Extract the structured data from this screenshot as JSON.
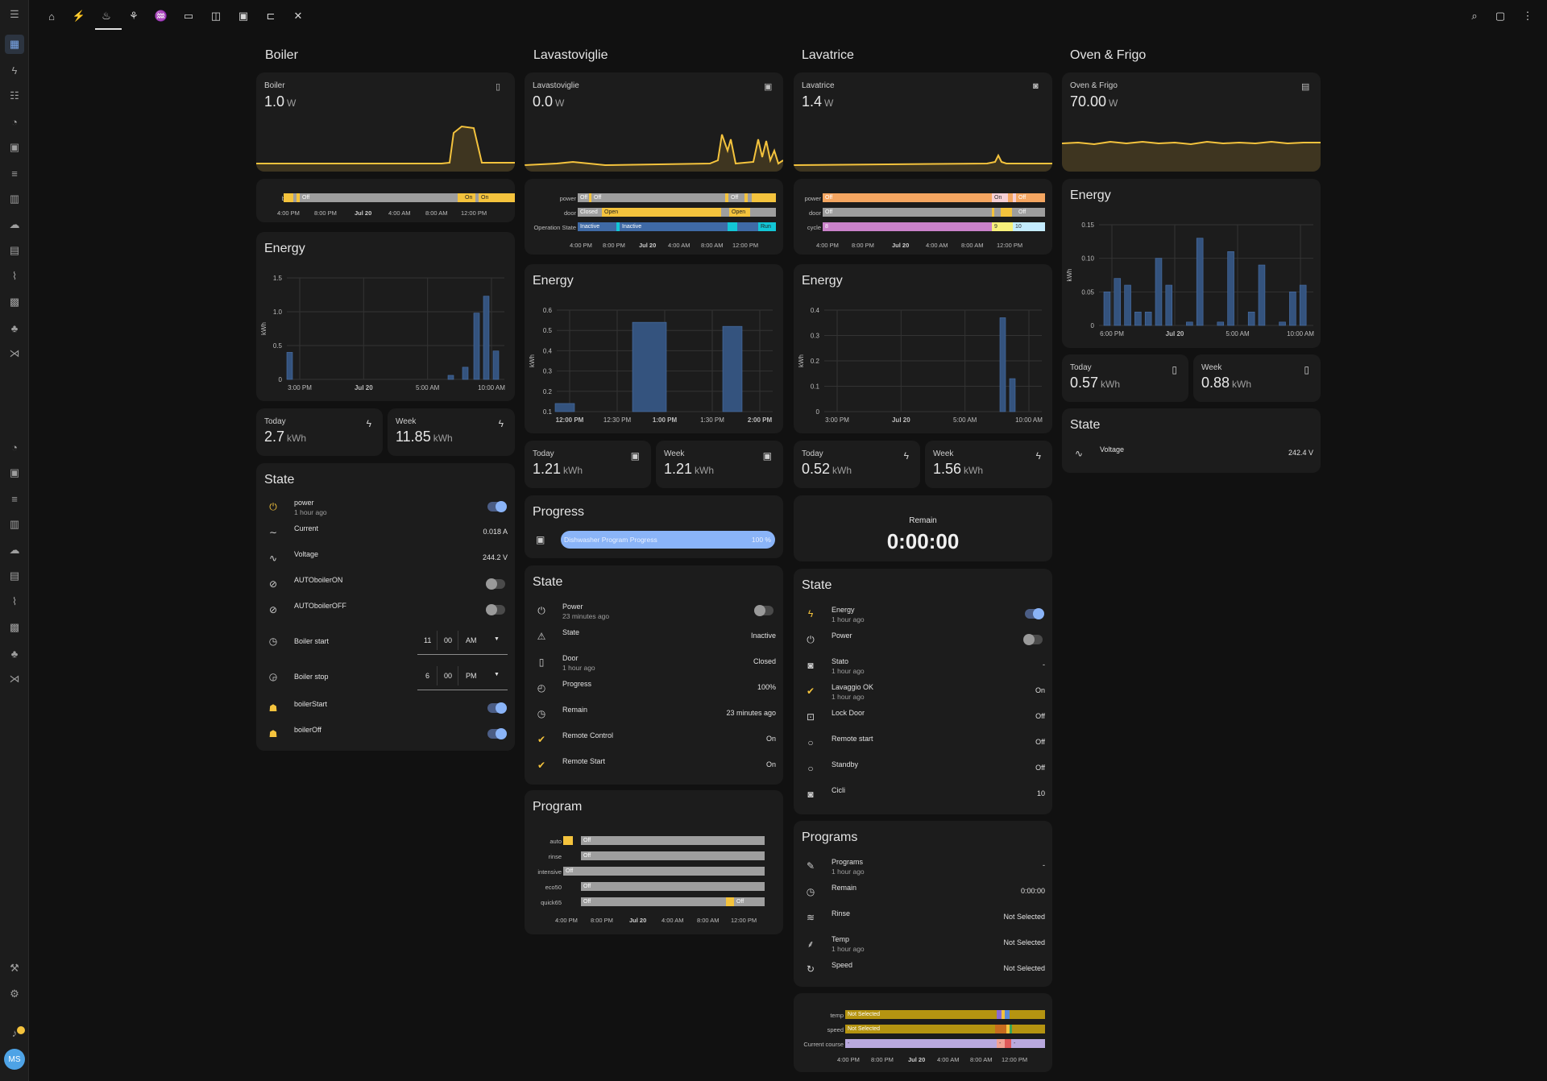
{
  "user": {
    "initials": "MS"
  },
  "topbar_icons": [
    "home-icon",
    "plug-icon",
    "dishwasher-icon",
    "washing-machine-icon",
    "radiator-icon",
    "monitor-icon",
    "toggle-panel-icon",
    "panel-icon",
    "tree-icon",
    "tools-icon"
  ],
  "columns": {
    "boiler": {
      "title": "Boiler",
      "sensor": {
        "name": "Boiler",
        "value": "1.0",
        "unit": "W"
      },
      "timeline": {
        "rows": [
          {
            "label": "boiler",
            "segments": [
              "Off",
              "On",
              "On"
            ]
          }
        ],
        "ticks": [
          "4:00 PM",
          "8:00 PM",
          "Jul 20",
          "4:00 AM",
          "8:00 AM",
          "12:00 PM"
        ]
      },
      "energy": {
        "title": "Energy",
        "chart_data": {
          "type": "bar",
          "ylabel": "kWh",
          "ylim": [
            0,
            1.5
          ],
          "yticks": [
            "1.5",
            "1.0",
            "0.5",
            "0"
          ],
          "xticks": [
            "3:00 PM",
            "Jul 20",
            "5:00 AM",
            "10:00 AM"
          ],
          "x": [
            "3:00 PM",
            "8:00 AM",
            "9:00 AM",
            "10:00 AM",
            "11:00 AM",
            "12:00 PM"
          ],
          "values": [
            0.4,
            0.06,
            0.18,
            0.98,
            1.23,
            0.42
          ]
        }
      },
      "today": {
        "label": "Today",
        "value": "2.7",
        "unit": "kWh"
      },
      "week": {
        "label": "Week",
        "value": "11.85",
        "unit": "kWh"
      },
      "state": {
        "title": "State",
        "rows": [
          {
            "name": "power",
            "sub": "1 hour ago",
            "value": ""
          },
          {
            "name": "Current",
            "sub": "",
            "value": "0.018 A"
          },
          {
            "name": "Voltage",
            "sub": "",
            "value": "244.2 V"
          },
          {
            "name": "AUTOboilerON",
            "sub": "",
            "value": ""
          },
          {
            "name": "AUTOboilerOFF",
            "sub": "",
            "value": ""
          },
          {
            "name": "Boiler start",
            "sub": "",
            "value": ""
          },
          {
            "name": "Boiler stop",
            "sub": "",
            "value": ""
          },
          {
            "name": "boilerStart",
            "sub": "",
            "value": ""
          },
          {
            "name": "boilerOff",
            "sub": "",
            "value": ""
          }
        ],
        "start_time": {
          "h": "11",
          "m": "00",
          "ampm": "AM"
        },
        "stop_time": {
          "h": "6",
          "m": "00",
          "ampm": "PM"
        }
      }
    },
    "lavastoviglie": {
      "title": "Lavastoviglie",
      "sensor": {
        "name": "Lavastoviglie",
        "value": "0.0",
        "unit": "W"
      },
      "timeline": {
        "rows": [
          {
            "label": "power",
            "segments": [
              "Off",
              "Off",
              "Off"
            ]
          },
          {
            "label": "door",
            "segments": [
              "Closed",
              "Open",
              "Open"
            ]
          },
          {
            "label": "Operation State",
            "segments": [
              "Inactive",
              "Inactive",
              "Run"
            ]
          }
        ],
        "ticks": [
          "4:00 PM",
          "8:00 PM",
          "Jul 20",
          "4:00 AM",
          "8:00 AM",
          "12:00 PM"
        ]
      },
      "energy": {
        "title": "Energy",
        "chart_data": {
          "type": "bar",
          "ylabel": "kWh",
          "ylim": [
            0.1,
            0.6
          ],
          "yticks": [
            "0.6",
            "0.5",
            "0.4",
            "0.3",
            "0.2",
            "0.1"
          ],
          "xticks": [
            "12:00 PM",
            "12:30 PM",
            "1:00 PM",
            "1:30 PM",
            "2:00 PM"
          ],
          "x": [
            "12:00 PM",
            "1:00 PM",
            "2:00 PM"
          ],
          "values": [
            0.14,
            0.54,
            0.52
          ]
        }
      },
      "today": {
        "label": "Today",
        "value": "1.21",
        "unit": "kWh"
      },
      "week": {
        "label": "Week",
        "value": "1.21",
        "unit": "kWh"
      },
      "progress": {
        "title": "Progress",
        "label": "Dishwasher Program Progress",
        "value_text": "100 %",
        "value": 100
      },
      "state": {
        "title": "State",
        "rows": [
          {
            "name": "Power",
            "sub": "23 minutes ago",
            "value": ""
          },
          {
            "name": "State",
            "sub": "",
            "value": "Inactive"
          },
          {
            "name": "Door",
            "sub": "1 hour ago",
            "value": "Closed"
          },
          {
            "name": "Progress",
            "sub": "",
            "value": "100%"
          },
          {
            "name": "Remain",
            "sub": "",
            "value": "23 minutes ago"
          },
          {
            "name": "Remote Control",
            "sub": "",
            "value": "On"
          },
          {
            "name": "Remote Start",
            "sub": "",
            "value": "On"
          }
        ]
      },
      "program": {
        "title": "Program",
        "rows": [
          {
            "label": "auto",
            "segments": [
              "Off"
            ]
          },
          {
            "label": "rinse",
            "segments": [
              "Off"
            ]
          },
          {
            "label": "intensive",
            "segments": [
              "Off"
            ]
          },
          {
            "label": "eco50",
            "segments": [
              "Off"
            ]
          },
          {
            "label": "quick65",
            "segments": [
              "Off",
              "Off"
            ]
          }
        ],
        "ticks": [
          "4:00 PM",
          "8:00 PM",
          "Jul 20",
          "4:00 AM",
          "8:00 AM",
          "12:00 PM"
        ]
      }
    },
    "lavatrice": {
      "title": "Lavatrice",
      "sensor": {
        "name": "Lavatrice",
        "value": "1.4",
        "unit": "W"
      },
      "timeline": {
        "rows": [
          {
            "label": "power",
            "segments": [
              "Off",
              "On",
              "Off"
            ]
          },
          {
            "label": "door",
            "segments": [
              "Off",
              "Off"
            ]
          },
          {
            "label": "cycle",
            "segments": [
              "8",
              "9",
              "10"
            ]
          }
        ],
        "ticks": [
          "4:00 PM",
          "8:00 PM",
          "Jul 20",
          "4:00 AM",
          "8:00 AM",
          "12:00 PM"
        ]
      },
      "energy": {
        "title": "Energy",
        "chart_data": {
          "type": "bar",
          "ylabel": "kWh",
          "ylim": [
            0,
            0.4
          ],
          "yticks": [
            "0.4",
            "0.3",
            "0.2",
            "0.1",
            "0"
          ],
          "xticks": [
            "3:00 PM",
            "Jul 20",
            "5:00 AM",
            "10:00 AM"
          ],
          "x": [
            "10:00 AM",
            "11:00 AM"
          ],
          "values": [
            0.37,
            0.13
          ]
        }
      },
      "today": {
        "label": "Today",
        "value": "0.52",
        "unit": "kWh"
      },
      "week": {
        "label": "Week",
        "value": "1.56",
        "unit": "kWh"
      },
      "remain": {
        "label": "Remain",
        "value": "0:00:00"
      },
      "state": {
        "title": "State",
        "rows": [
          {
            "name": "Energy",
            "sub": "1 hour ago",
            "value": ""
          },
          {
            "name": "Power",
            "sub": "",
            "value": ""
          },
          {
            "name": "Stato",
            "sub": "1 hour ago",
            "value": "-"
          },
          {
            "name": "Lavaggio OK",
            "sub": "1 hour ago",
            "value": "On"
          },
          {
            "name": "Lock Door",
            "sub": "",
            "value": "Off"
          },
          {
            "name": "Remote start",
            "sub": "",
            "value": "Off"
          },
          {
            "name": "Standby",
            "sub": "",
            "value": "Off"
          },
          {
            "name": "Cicli",
            "sub": "",
            "value": "10"
          }
        ]
      },
      "programs": {
        "title": "Programs",
        "rows": [
          {
            "name": "Programs",
            "sub": "1 hour ago",
            "value": "-"
          },
          {
            "name": "Remain",
            "sub": "",
            "value": "0:00:00"
          },
          {
            "name": "Rinse",
            "sub": "",
            "value": "Not Selected"
          },
          {
            "name": "Temp",
            "sub": "1 hour ago",
            "value": "Not Selected"
          },
          {
            "name": "Speed",
            "sub": "",
            "value": "Not Selected"
          }
        ]
      },
      "course_timeline": {
        "rows": [
          {
            "label": "temp",
            "segments": [
              "Not Selected"
            ]
          },
          {
            "label": "speed",
            "segments": [
              "Not Selected"
            ]
          },
          {
            "label": "Current course",
            "segments": [
              "-",
              "-",
              "-"
            ]
          }
        ],
        "ticks": [
          "4:00 PM",
          "8:00 PM",
          "Jul 20",
          "4:00 AM",
          "8:00 AM",
          "12:00 PM"
        ]
      }
    },
    "oven": {
      "title": "Oven & Frigo",
      "sensor": {
        "name": "Oven & Frigo",
        "value": "70.00",
        "unit": "W"
      },
      "energy": {
        "title": "Energy",
        "chart_data": {
          "type": "bar",
          "ylabel": "kWh",
          "ylim": [
            0,
            0.15
          ],
          "yticks": [
            "0.15",
            "0.10",
            "0.05",
            "0"
          ],
          "xticks": [
            "6:00 PM",
            "Jul 20",
            "5:00 AM",
            "10:00 AM"
          ],
          "values": [
            0.05,
            0.07,
            0.06,
            0.02,
            0.02,
            0.1,
            0.06,
            0,
            0.005,
            0.13,
            0,
            0.005,
            0.11,
            0,
            0.02,
            0.09,
            0,
            0.005,
            0.05,
            0.06
          ]
        }
      },
      "today": {
        "label": "Today",
        "value": "0.57",
        "unit": "kWh"
      },
      "week": {
        "label": "Week",
        "value": "0.88",
        "unit": "kWh"
      },
      "state": {
        "title": "State",
        "rows": [
          {
            "name": "Voltage",
            "sub": "",
            "value": "242.4 V"
          }
        ]
      }
    }
  },
  "colors": {
    "accent": "#f4c33d",
    "bar": "#34537e",
    "toggle_on": "#8ab4f8",
    "off_gray": "#9e9e9e"
  }
}
